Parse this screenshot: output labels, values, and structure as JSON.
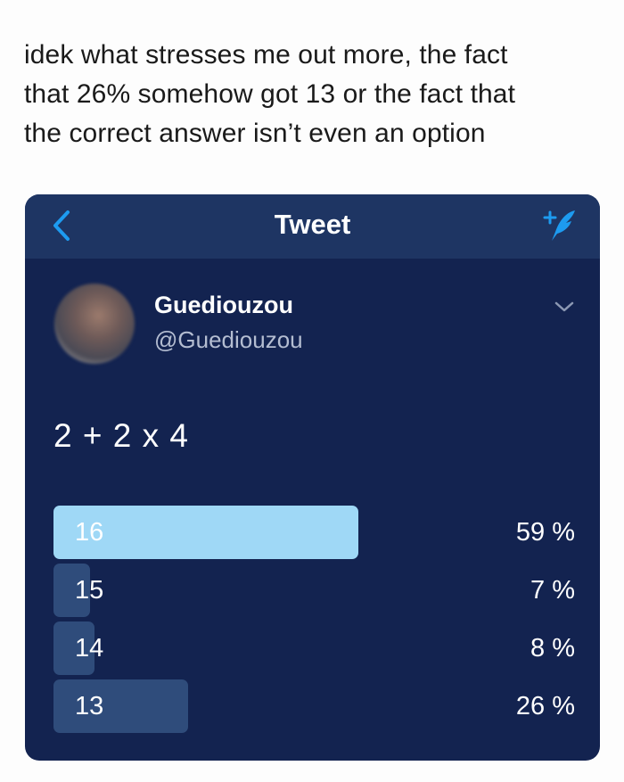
{
  "caption": {
    "line1": "idek what stresses me out more, the fact",
    "line2": "that 26% somehow got 13 or the fact that",
    "line3": "the correct answer isn’t even an option"
  },
  "navbar": {
    "title": "Tweet",
    "back_icon": "chevron-left-icon",
    "compose_icon": "compose-tweet-icon"
  },
  "tweet": {
    "display_name": "Guediouzou",
    "handle": "@Guediouzou",
    "text": "2 + 2 x 4",
    "menu_icon": "chevron-down-icon"
  },
  "poll": {
    "options": [
      {
        "label": "16",
        "percent_label": "59 %",
        "percent": 59,
        "leader": true
      },
      {
        "label": "15",
        "percent_label": "7 %",
        "percent": 7,
        "leader": false
      },
      {
        "label": "14",
        "percent_label": "8 %",
        "percent": 8,
        "leader": false
      },
      {
        "label": "13",
        "percent_label": "26 %",
        "percent": 26,
        "leader": false
      }
    ]
  },
  "colors": {
    "card_background": "#132350",
    "navbar_background": "#1e3563",
    "accent": "#1d9bf0",
    "leading_bar": "#9fd8f6",
    "bar": "#2f4c7b"
  }
}
